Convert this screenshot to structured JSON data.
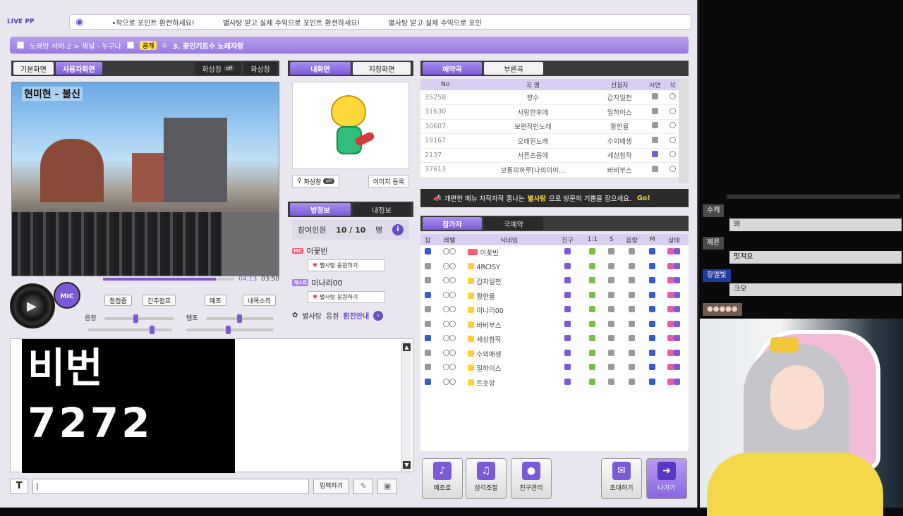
{
  "app": {
    "logo": "LIVE PP"
  },
  "ticker": [
    "•작으로 포인트 환전하세요!",
    "별사탕 받고 실제 수익으로 포인트 환전하세요!",
    "별사탕 받고 실제 수익으로 포인"
  ],
  "room": {
    "breadcrumb": "노래방 서버-2 > 채널 - 누구나",
    "badge": "공개",
    "title": "3. 꽃인기트수 노래자랑"
  },
  "video": {
    "tabs": [
      "기본화면",
      "사용자화면"
    ],
    "controls": [
      "화상창",
      "off",
      "화상창"
    ],
    "title": "현미현 - 불신",
    "time_current": "04:13",
    "time_total": "03:50",
    "progress": 0.86
  },
  "player": {
    "mic_label": "MIC",
    "buttons": [
      "점점줌",
      "간주점프",
      "예조",
      "내목소리"
    ],
    "vol_label": "음정",
    "tempo_label": "템포",
    "pitch_value": 0.45,
    "tempo_value": 0.5
  },
  "chat": {
    "sign_line1": "비번",
    "sign_line2": "7272",
    "input_value": "|",
    "send_label": "입력하기"
  },
  "my": {
    "tabs": [
      "내화면",
      "지정화면"
    ],
    "cam_label": "화상창",
    "cam_state": "off",
    "image_btn": "이미지 등록"
  },
  "bj": {
    "tabs": [
      "방정보",
      "내정보"
    ],
    "fan_label": "참여인원",
    "fan_count": "10 / 10",
    "fan_unit": "명",
    "entries": [
      {
        "role": "MC",
        "name": "이꽃빈",
        "support": "별사탕 응원하기"
      },
      {
        "role": "게스트",
        "name": "미나리00",
        "support": "별사탕 응원하기"
      }
    ],
    "guide_prefix": "별사탕",
    "guide_mid": "응원",
    "guide_suffix": "환전안내"
  },
  "songs": {
    "tabs": [
      "예약곡",
      "부른곡"
    ],
    "headers": [
      "No",
      "곡 명",
      "신청자",
      "시연",
      "삭"
    ],
    "rows": [
      {
        "no": "35258",
        "title": "향수",
        "requester": "갑자일천"
      },
      {
        "no": "31630",
        "title": "사랑한후에",
        "requester": "일하이스"
      },
      {
        "no": "30607",
        "title": "보편적인노래",
        "requester": "황한율"
      },
      {
        "no": "19167",
        "title": "오래된노래",
        "requester": "수의매생"
      },
      {
        "no": "2137",
        "title": "서른즈음에",
        "requester": "세상참작"
      },
      {
        "no": "37613",
        "title": "보통의하루[나의이야...",
        "requester": "바비부스"
      }
    ]
  },
  "banner": {
    "prefix": "개편한 메뉴 자작자작 흥나는",
    "highlight": "별사탕",
    "suffix": "으로 방문의 기쁨을 잡으세요.",
    "go": "Go!"
  },
  "users": {
    "tabs": [
      "참가자",
      "국예약"
    ],
    "headers": [
      "참",
      "레벨",
      "닉네임",
      "친구",
      "1:1",
      "S",
      "음량",
      "M",
      "상태"
    ],
    "rows": [
      {
        "nick": "이꽃빈",
        "mc": true
      },
      {
        "nick": "4RCISY",
        "mc": false
      },
      {
        "nick": "갑자일천",
        "mc": false
      },
      {
        "nick": "황한율",
        "mc": false
      },
      {
        "nick": "미나리00",
        "mc": false
      },
      {
        "nick": "바비부스",
        "mc": false
      },
      {
        "nick": "세상참작",
        "mc": false
      },
      {
        "nick": "수의매생",
        "mc": false
      },
      {
        "nick": "일하이스",
        "mc": false
      },
      {
        "nick": "트숏앙",
        "mc": false
      }
    ]
  },
  "bottom": {
    "buttons": [
      "예조로",
      "삼각조절",
      "친구관리",
      "초대하기",
      "나가기"
    ]
  },
  "sidechat": [
    {
      "name": "수캐",
      "text": "와"
    },
    {
      "name": "제욘",
      "text": "멋져요"
    },
    {
      "name": "장엘빛",
      "text": "크오"
    },
    {
      "name": "●●●●●",
      "text": ""
    }
  ],
  "colors": {
    "accent": "#7c5ad6",
    "accent_light": "#b9a0ee",
    "highlight": "#ffd93a"
  }
}
